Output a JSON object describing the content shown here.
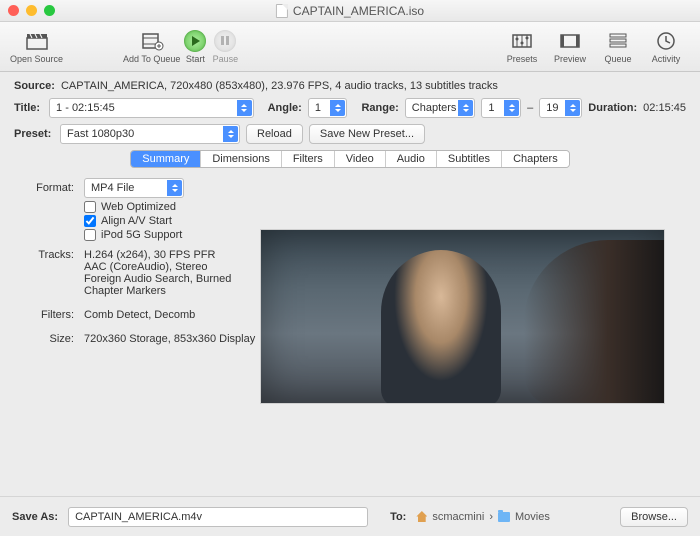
{
  "window": {
    "title": "CAPTAIN_AMERICA.iso"
  },
  "toolbar": {
    "open_source": "Open Source",
    "add_to_queue": "Add To Queue",
    "start": "Start",
    "pause": "Pause",
    "presets": "Presets",
    "preview": "Preview",
    "queue": "Queue",
    "activity": "Activity"
  },
  "source": {
    "label": "Source:",
    "value": "CAPTAIN_AMERICA, 720x480 (853x480), 23.976 FPS, 4 audio tracks, 13 subtitles tracks"
  },
  "title": {
    "label": "Title:",
    "value": "1 - 02:15:45",
    "angle_label": "Angle:",
    "angle_value": "1",
    "range_label": "Range:",
    "range_type": "Chapters",
    "range_from": "1",
    "range_sep": "–",
    "range_to": "19",
    "duration_label": "Duration:",
    "duration_value": "02:15:45"
  },
  "preset": {
    "label": "Preset:",
    "value": "Fast 1080p30",
    "reload": "Reload",
    "save_new": "Save New Preset..."
  },
  "tabs": [
    "Summary",
    "Dimensions",
    "Filters",
    "Video",
    "Audio",
    "Subtitles",
    "Chapters"
  ],
  "summary": {
    "format_label": "Format:",
    "format_value": "MP4 File",
    "web_optimized": "Web Optimized",
    "align_av": "Align A/V Start",
    "ipod": "iPod 5G Support",
    "tracks_label": "Tracks:",
    "tracks_lines": [
      "H.264 (x264), 30 FPS PFR",
      "AAC (CoreAudio), Stereo",
      "Foreign Audio Search, Burned",
      "Chapter Markers"
    ],
    "filters_label": "Filters:",
    "filters_value": "Comb Detect, Decomb",
    "size_label": "Size:",
    "size_value": "720x360 Storage, 853x360 Display"
  },
  "saveas": {
    "label": "Save As:",
    "value": "CAPTAIN_AMERICA.m4v",
    "to_label": "To:",
    "host": "scmacmini",
    "sep": "›",
    "folder": "Movies",
    "browse": "Browse..."
  }
}
